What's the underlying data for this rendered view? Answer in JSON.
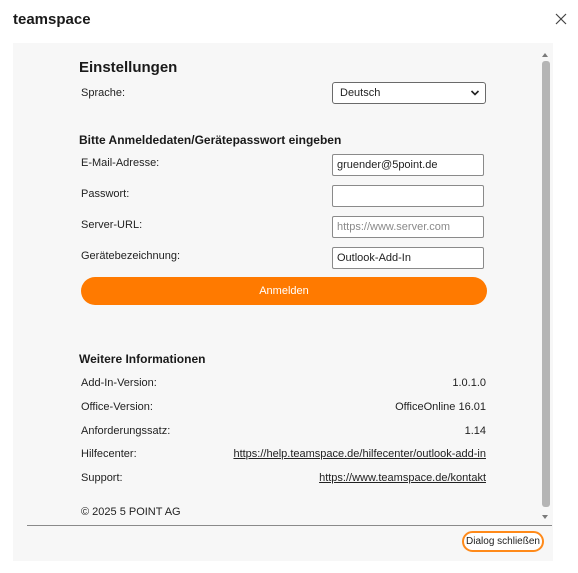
{
  "app": {
    "title": "teamspace"
  },
  "settings": {
    "heading": "Einstellungen",
    "language_label": "Sprache:",
    "language_value": "Deutsch"
  },
  "login": {
    "heading": "Bitte Anmeldedaten/Gerätepasswort eingeben",
    "email_label": "E-Mail-Adresse:",
    "email_value": "gruender@5point.de",
    "password_label": "Passwort:",
    "password_value": "",
    "server_label": "Server-URL:",
    "server_placeholder": "https://www.server.com",
    "device_label": "Gerätebezeichnung:",
    "device_value": "Outlook-Add-In",
    "submit_label": "Anmelden",
    "accent_color": "#ff7a00"
  },
  "info": {
    "heading": "Weitere Informationen",
    "rows": [
      {
        "label": "Add-In-Version:",
        "value": "1.0.1.0"
      },
      {
        "label": "Office-Version:",
        "value": "OfficeOnline 16.01"
      },
      {
        "label": "Anforderungssatz:",
        "value": "1.14"
      },
      {
        "label": "Hilfecenter:",
        "value": "https://help.teamspace.de/hilfecenter/outlook-add-in"
      },
      {
        "label": "Support:",
        "value": "https://www.teamspace.de/kontakt"
      }
    ],
    "copyright": "© 2025 5 POINT AG"
  },
  "footer": {
    "close_dialog_label": "Dialog schließen"
  },
  "icons": {
    "close": "close-icon",
    "dropdown": "chevron-down-icon"
  }
}
